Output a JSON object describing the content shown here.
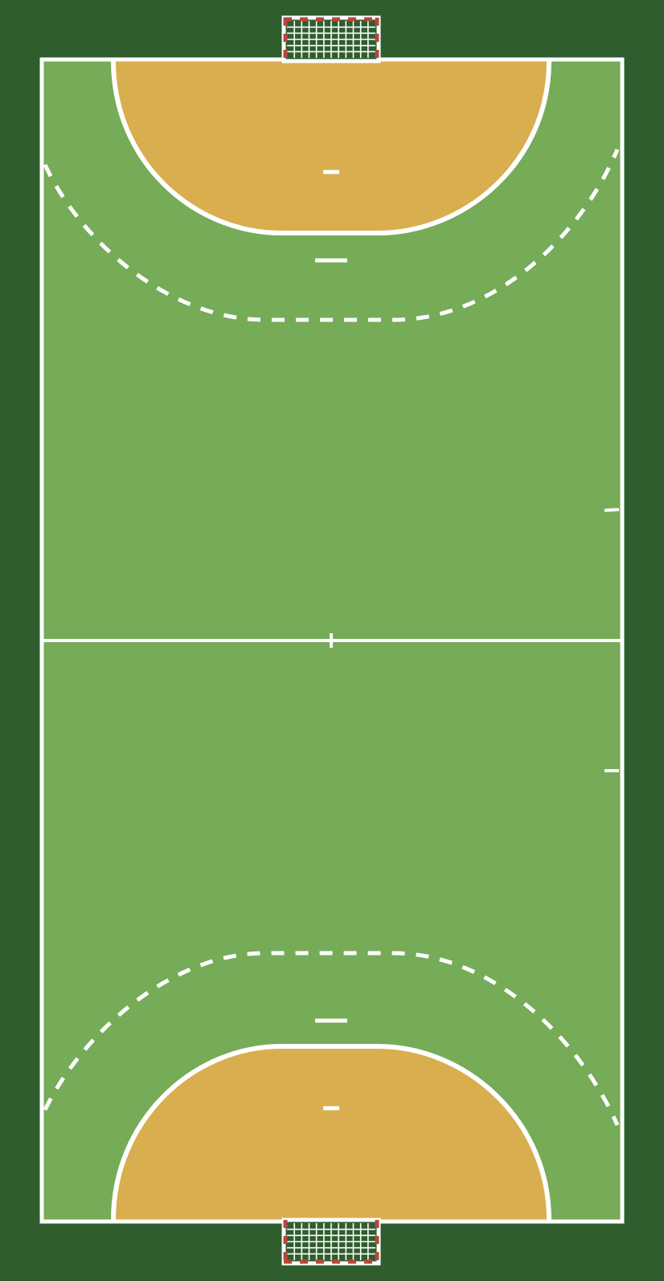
{
  "court": {
    "sport": "handball",
    "colors": {
      "surround": "#2f5d2e",
      "playing_area": "#76ab58",
      "goal_area": "#d8ae4f",
      "lines": "#ffffff",
      "goal_post_red": "#b5473e",
      "goal_net": "#2f5d2e"
    },
    "goals": [
      "top",
      "bottom"
    ],
    "lines": {
      "goal_area_line": "solid",
      "free_throw_line": "dashed",
      "center_line": "solid",
      "seven_meter_line": "solid",
      "goalkeeper_restraining_line": "solid",
      "substitution_marks": "right sideline"
    }
  }
}
